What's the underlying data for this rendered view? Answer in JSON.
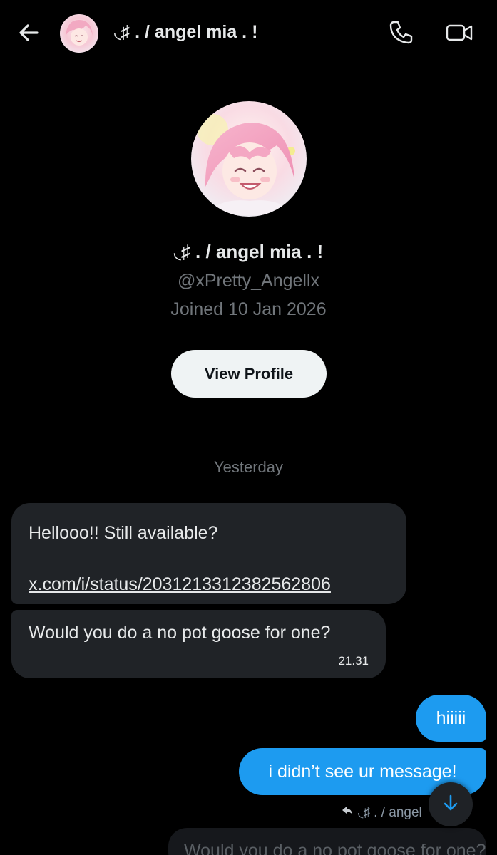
{
  "header": {
    "title": "◟♯ . / angel mia . !",
    "back_icon": "arrow-left-icon",
    "call_icon": "phone-icon",
    "video_icon": "video-camera-icon"
  },
  "profile": {
    "name": "◟♯ . / angel mia . !",
    "handle": "@xPretty_Angellx",
    "joined": "Joined 10 Jan 2026",
    "view_profile_label": "View Profile"
  },
  "conversation": {
    "date_separator": "Yesterday",
    "messages": [
      {
        "direction": "incoming",
        "text": "Hellooo!! Still available?",
        "link": "x.com/i/status/2031213312382562806"
      },
      {
        "direction": "incoming",
        "text": "Would you do a no pot goose for one?",
        "time": "21.31"
      },
      {
        "direction": "outgoing",
        "text": "hiiiii"
      },
      {
        "direction": "outgoing",
        "text": "i didn’t see ur message!"
      }
    ],
    "reply_tag": "◟♯ . / angel",
    "quoted_preview": "Would you do a no pot goose for one?"
  },
  "colors": {
    "background": "#000000",
    "accent": "#1d9bf0",
    "incoming_bubble": "#202327",
    "muted_text": "#71767b"
  }
}
